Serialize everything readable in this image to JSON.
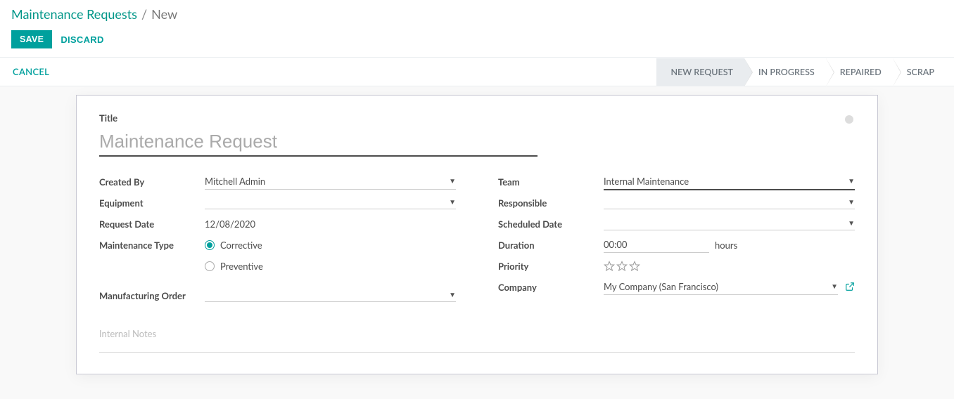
{
  "breadcrumb": {
    "root": "Maintenance Requests",
    "sep": "/",
    "current": "New"
  },
  "buttons": {
    "save": "SAVE",
    "discard": "DISCARD",
    "cancel": "CANCEL"
  },
  "stages": [
    "NEW REQUEST",
    "IN PROGRESS",
    "REPAIRED",
    "SCRAP"
  ],
  "active_stage": 0,
  "title": {
    "label": "Title",
    "placeholder": "Maintenance Request",
    "value": ""
  },
  "left": {
    "created_by": {
      "label": "Created By",
      "value": "Mitchell Admin"
    },
    "equipment": {
      "label": "Equipment",
      "value": ""
    },
    "request_date": {
      "label": "Request Date",
      "value": "12/08/2020"
    },
    "maintenance_type": {
      "label": "Maintenance Type",
      "options": [
        "Corrective",
        "Preventive"
      ],
      "selected": "Corrective"
    },
    "manufacturing_order": {
      "label": "Manufacturing Order",
      "value": ""
    }
  },
  "right": {
    "team": {
      "label": "Team",
      "value": "Internal Maintenance"
    },
    "responsible": {
      "label": "Responsible",
      "value": ""
    },
    "scheduled_date": {
      "label": "Scheduled Date",
      "value": ""
    },
    "duration": {
      "label": "Duration",
      "value": "00:00",
      "unit": "hours"
    },
    "priority": {
      "label": "Priority",
      "stars": 3,
      "value": 0
    },
    "company": {
      "label": "Company",
      "value": "My Company (San Francisco)"
    }
  },
  "notes_placeholder": "Internal Notes"
}
